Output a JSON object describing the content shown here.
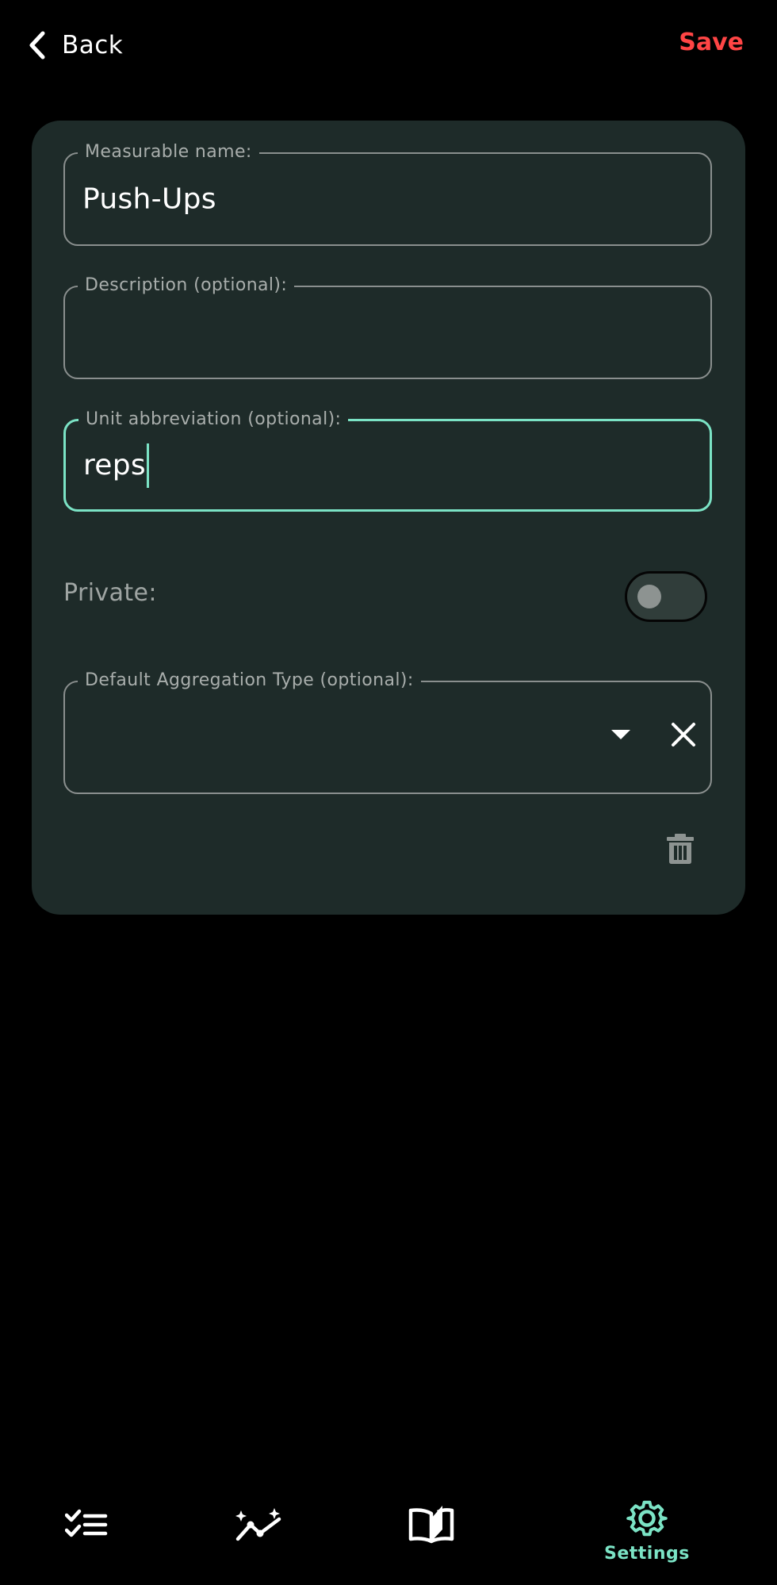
{
  "header": {
    "back_label": "Back",
    "save_label": "Save"
  },
  "form": {
    "name": {
      "label": "Measurable name:",
      "value": "Push-Ups"
    },
    "description": {
      "label": "Description (optional):",
      "value": ""
    },
    "unit": {
      "label": "Unit abbreviation (optional):",
      "value": "reps"
    },
    "private": {
      "label": "Private:",
      "enabled": false
    },
    "aggregation": {
      "label": "Default Aggregation Type (optional):",
      "value": ""
    }
  },
  "bottom_nav": {
    "items": [
      {
        "icon": "checklist-icon",
        "label": ""
      },
      {
        "icon": "chart-sparkle-icon",
        "label": ""
      },
      {
        "icon": "open-book-icon",
        "label": ""
      },
      {
        "icon": "gear-icon",
        "label": "Settings"
      }
    ]
  },
  "colors": {
    "background": "#000000",
    "card": "#1e2b29",
    "accent": "#7be3c5",
    "save": "#ff4545",
    "outline": "#8a8f8e"
  }
}
